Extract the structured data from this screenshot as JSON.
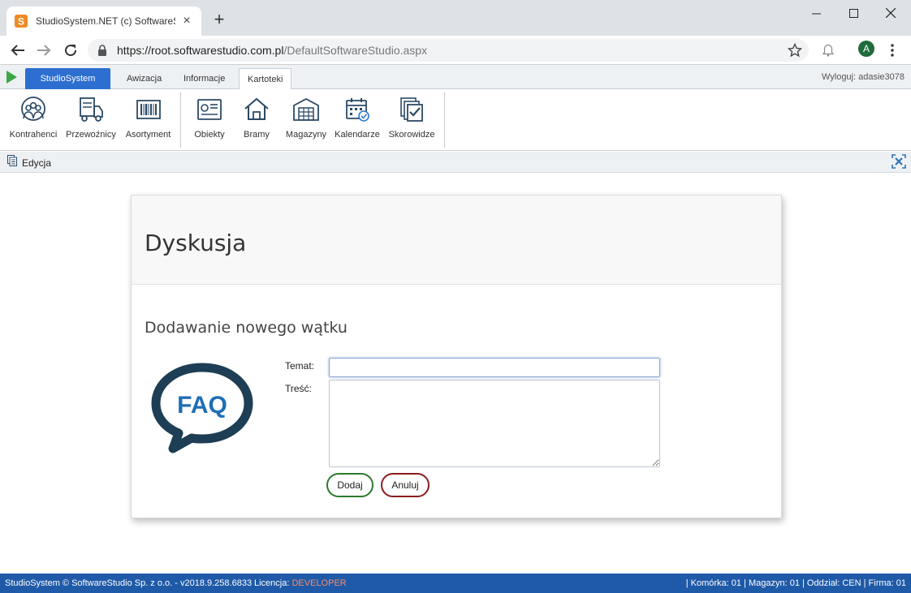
{
  "browser": {
    "tab_title": "StudioSystem.NET (c) SoftwareSt",
    "url_host": "https://root.softwarestudio.com.pl",
    "url_path": "/DefaultSoftwareStudio.aspx",
    "avatar_letter": "A",
    "new_tab_label": "+",
    "close_tab_label": "×"
  },
  "app": {
    "tabs": [
      {
        "label": "StudioSystem"
      },
      {
        "label": "Awizacja"
      },
      {
        "label": "Informacje"
      },
      {
        "label": "Kartoteki"
      }
    ],
    "logout": "Wyloguj: adasie3078",
    "ribbon": [
      {
        "label": "Kontrahenci",
        "icon": "contractors-icon"
      },
      {
        "label": "Przewoźnicy",
        "icon": "truck-icon"
      },
      {
        "label": "Asortyment",
        "icon": "barcode-icon"
      },
      {
        "label": "Obiekty",
        "icon": "object-icon"
      },
      {
        "label": "Bramy",
        "icon": "house-icon"
      },
      {
        "label": "Magazyny",
        "icon": "warehouse-icon"
      },
      {
        "label": "Kalendarze",
        "icon": "calendar-icon"
      },
      {
        "label": "Skorowidze",
        "icon": "index-icon"
      }
    ],
    "edit_label": "Edycja"
  },
  "card": {
    "title": "Dyskusja",
    "subtitle": "Dodawanie nowego wątku",
    "faq_text": "FAQ",
    "temat_label": "Temat:",
    "temat_value": "",
    "tresc_label": "Treść:",
    "tresc_value": "",
    "add_button": "Dodaj",
    "cancel_button": "Anuluj"
  },
  "status": {
    "left": "StudioSystem © SoftwareStudio Sp. z o.o. - v2018.9.258.6833",
    "license_label": "Licencja:",
    "license_value": "DEVELOPER",
    "right": "| Komórka: 01 | Magazyn: 01 | Oddział: CEN | Firma: 01"
  },
  "colors": {
    "primary_tab": "#2d6fd0",
    "status_bar": "#1f5aa8",
    "add_border": "#2c7a2c",
    "cancel_border": "#8b1c1c",
    "faq_blue": "#1f6eb5",
    "faq_dark": "#1d3e54"
  }
}
